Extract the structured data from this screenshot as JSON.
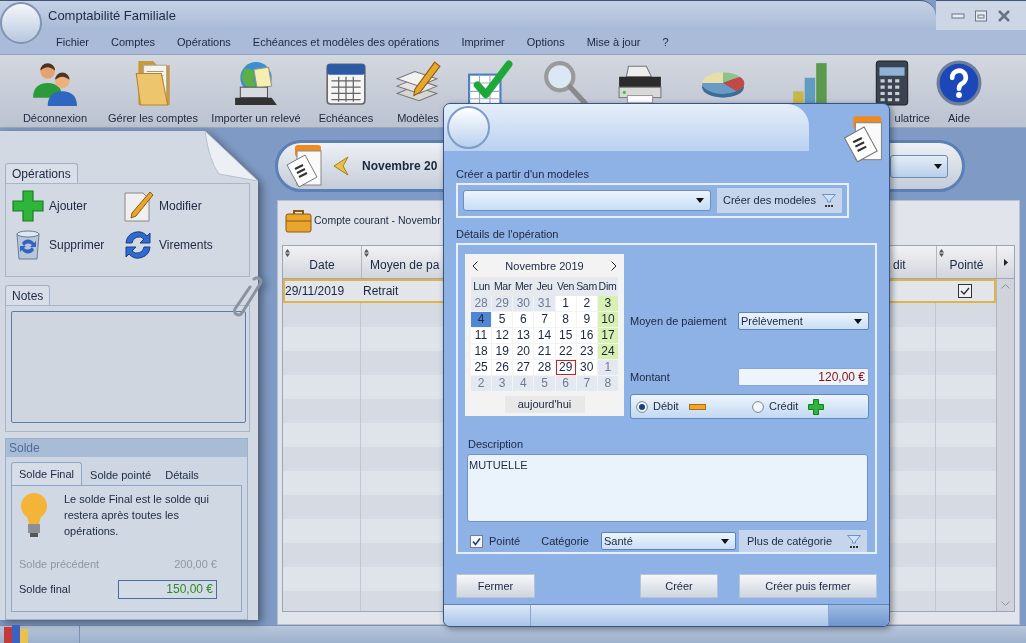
{
  "window": {
    "title": "Comptabilité Familiale"
  },
  "menu": [
    "Fichier",
    "Comptes",
    "Opérations",
    "Echéances et modèles des opérations",
    "Imprimer",
    "Options",
    "Mise à jour",
    "?"
  ],
  "toolbar": [
    {
      "kind": "users",
      "label": "Déconnexion"
    },
    {
      "kind": "folder",
      "label": "Gérer les comptes"
    },
    {
      "kind": "import",
      "label": "Importer un relevé"
    },
    {
      "kind": "schedule",
      "label": "Echéances"
    },
    {
      "kind": "templates",
      "label": "Modèles"
    },
    {
      "kind": "check"
    },
    {
      "kind": "search"
    },
    {
      "kind": "printer"
    },
    {
      "kind": "pie"
    },
    {
      "kind": "bars"
    },
    {
      "kind": "calculator",
      "label": "ulatrice"
    },
    {
      "kind": "help",
      "label": "Aide"
    }
  ],
  "sidebar": {
    "operations": {
      "tab": "Opérations",
      "actions": [
        {
          "kind": "add",
          "label": "Ajouter"
        },
        {
          "kind": "edit",
          "label": "Modifier"
        },
        {
          "kind": "delete",
          "label": "Supprimer"
        },
        {
          "kind": "transfer",
          "label": "Virements"
        }
      ]
    },
    "notes": {
      "tab": "Notes"
    },
    "balance": {
      "title": "Solde",
      "tabs": [
        {
          "label": "Solde Final",
          "selected": true
        },
        {
          "label": "Solde pointé",
          "selected": false
        },
        {
          "label": "Détails",
          "selected": false
        }
      ],
      "hint": "Le solde Final est le solde qui restera après toutes les opérations.",
      "previous": {
        "label": "Solde précédent",
        "value": "200,00 €",
        "disabled": true
      },
      "final": {
        "label": "Solde final",
        "value": "150,00 €"
      }
    }
  },
  "period": {
    "label": "Novembre 20"
  },
  "account": {
    "title": "Compte courant - Novembr"
  },
  "table": {
    "columns": [
      "Date",
      "Moyen de pa",
      "dit",
      "Pointé"
    ],
    "rows": [
      {
        "cells": [
          "29/11/2019",
          "Retrait"
        ],
        "checked": true,
        "selected": true
      }
    ]
  },
  "dialog": {
    "template": {
      "label": "Créer a partir d'un modeles",
      "button": "Créer des modeles"
    },
    "details": {
      "label": "Détails de l'opération",
      "calendar": {
        "month": "Novembre 2019",
        "weekdays": [
          "Lun",
          "Mar",
          "Mer",
          "Jeu",
          "Ven",
          "Sam",
          "Dim"
        ],
        "weeks": [
          [
            {
              "d": "28",
              "kind": "other",
              "selected": false,
              "today": false
            },
            {
              "d": "29",
              "kind": "other",
              "selected": false,
              "today": false
            },
            {
              "d": "30",
              "kind": "other",
              "selected": false,
              "today": false
            },
            {
              "d": "31",
              "kind": "other",
              "selected": false,
              "today": false
            },
            {
              "d": "1",
              "kind": "day",
              "selected": false,
              "today": false
            },
            {
              "d": "2",
              "kind": "day",
              "selected": false,
              "today": false
            },
            {
              "d": "3",
              "kind": "weekend",
              "selected": false,
              "today": false
            }
          ],
          [
            {
              "d": "4",
              "kind": "day",
              "selected": true,
              "today": false
            },
            {
              "d": "5",
              "kind": "day",
              "selected": false,
              "today": false
            },
            {
              "d": "6",
              "kind": "day",
              "selected": false,
              "today": false
            },
            {
              "d": "7",
              "kind": "day",
              "selected": false,
              "today": false
            },
            {
              "d": "8",
              "kind": "day",
              "selected": false,
              "today": false
            },
            {
              "d": "9",
              "kind": "day",
              "selected": false,
              "today": false
            },
            {
              "d": "10",
              "kind": "weekend",
              "selected": false,
              "today": false
            }
          ],
          [
            {
              "d": "11",
              "kind": "day",
              "selected": false,
              "today": false
            },
            {
              "d": "12",
              "kind": "day",
              "selected": false,
              "today": false
            },
            {
              "d": "13",
              "kind": "day",
              "selected": false,
              "today": false
            },
            {
              "d": "14",
              "kind": "day",
              "selected": false,
              "today": false
            },
            {
              "d": "15",
              "kind": "day",
              "selected": false,
              "today": false
            },
            {
              "d": "16",
              "kind": "day",
              "selected": false,
              "today": false
            },
            {
              "d": "17",
              "kind": "weekend",
              "selected": false,
              "today": false
            }
          ],
          [
            {
              "d": "18",
              "kind": "day",
              "selected": false,
              "today": false
            },
            {
              "d": "19",
              "kind": "day",
              "selected": false,
              "today": false
            },
            {
              "d": "20",
              "kind": "day",
              "selected": false,
              "today": false
            },
            {
              "d": "21",
              "kind": "day",
              "selected": false,
              "today": false
            },
            {
              "d": "22",
              "kind": "day",
              "selected": false,
              "today": false
            },
            {
              "d": "23",
              "kind": "day",
              "selected": false,
              "today": false
            },
            {
              "d": "24",
              "kind": "weekend",
              "selected": false,
              "today": false
            }
          ],
          [
            {
              "d": "25",
              "kind": "day",
              "selected": false,
              "today": false
            },
            {
              "d": "26",
              "kind": "day",
              "selected": false,
              "today": false
            },
            {
              "d": "27",
              "kind": "day",
              "selected": false,
              "today": false
            },
            {
              "d": "28",
              "kind": "day",
              "selected": false,
              "today": false
            },
            {
              "d": "29",
              "kind": "day",
              "selected": false,
              "today": true
            },
            {
              "d": "30",
              "kind": "day",
              "selected": false,
              "today": false
            },
            {
              "d": "1",
              "kind": "other",
              "selected": false,
              "today": false
            }
          ],
          [
            {
              "d": "2",
              "kind": "other",
              "selected": false,
              "today": false
            },
            {
              "d": "3",
              "kind": "other",
              "selected": false,
              "today": false
            },
            {
              "d": "4",
              "kind": "other",
              "selected": false,
              "today": false
            },
            {
              "d": "5",
              "kind": "other",
              "selected": false,
              "today": false
            },
            {
              "d": "6",
              "kind": "other",
              "selected": false,
              "today": false
            },
            {
              "d": "7",
              "kind": "other",
              "selected": false,
              "today": false
            },
            {
              "d": "8",
              "kind": "other",
              "selected": false,
              "today": false
            }
          ]
        ],
        "today_button": "aujourd'hui"
      },
      "payment": {
        "label": "Moyen de paiement",
        "value": "Prélèvement"
      },
      "amount": {
        "label": "Montant",
        "value": "120,00 €"
      },
      "direction": [
        {
          "kind": "debit",
          "label": "Débit",
          "selected": true
        },
        {
          "kind": "credit",
          "label": "Crédit",
          "selected": false
        }
      ],
      "description": {
        "label": "Description",
        "value": "MUTUELLE"
      },
      "pointed": {
        "label": "Pointé",
        "checked": true
      },
      "category": {
        "label": "Catégorie",
        "value": "Santé",
        "button": "Plus de catégorie"
      }
    },
    "buttons": [
      "Fermer",
      "Créer",
      "Créer puis fermer"
    ]
  }
}
